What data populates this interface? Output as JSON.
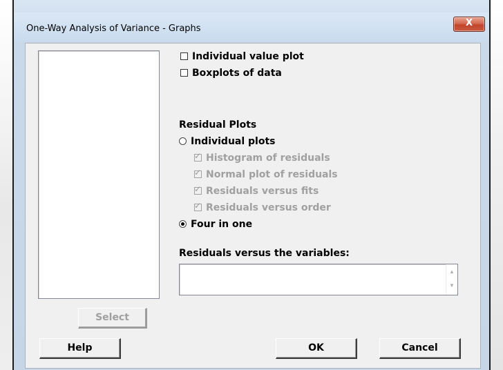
{
  "window": {
    "title": "One-Way Analysis of Variance - Graphs",
    "close_glyph": "X"
  },
  "graphs": {
    "individual_value_plot": {
      "label": "Individual value plot",
      "checked": false
    },
    "boxplots_of_data": {
      "label": "Boxplots of data",
      "checked": false
    }
  },
  "residual_plots": {
    "heading": "Residual Plots",
    "individual_plots": {
      "label": "Individual plots",
      "selected": false
    },
    "options": [
      {
        "label": "Histogram of residuals",
        "checked": true,
        "enabled": false
      },
      {
        "label": "Normal plot of residuals",
        "checked": true,
        "enabled": false
      },
      {
        "label": "Residuals versus fits",
        "checked": true,
        "enabled": false
      },
      {
        "label": "Residuals versus order",
        "checked": true,
        "enabled": false
      }
    ],
    "four_in_one": {
      "label": "Four in one",
      "selected": true
    }
  },
  "residuals_vs_variables": {
    "label": "Residuals versus the variables:",
    "value": ""
  },
  "buttons": {
    "select": "Select",
    "help": "Help",
    "ok": "OK",
    "cancel": "Cancel"
  }
}
